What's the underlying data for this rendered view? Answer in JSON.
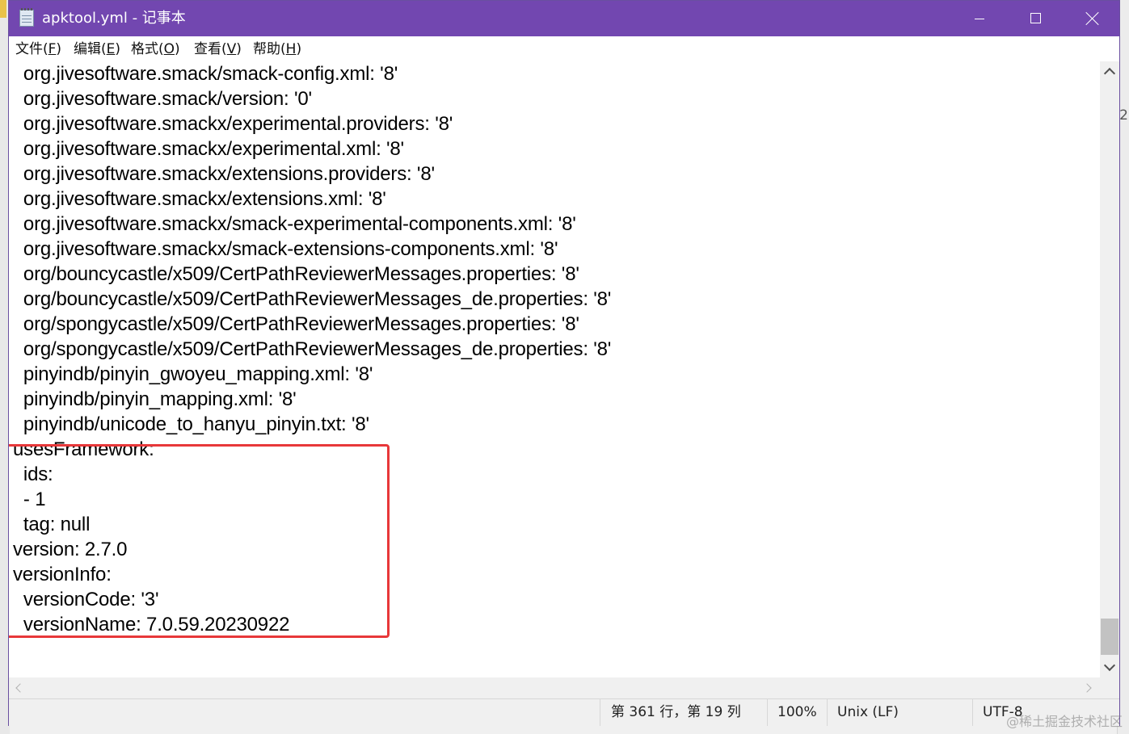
{
  "window": {
    "title": "apktool.yml - 记事本",
    "minimize_label": "minimize",
    "maximize_label": "maximize",
    "close_label": "close"
  },
  "menu": {
    "file": {
      "text": "文件(",
      "accel": "F",
      "end": ")"
    },
    "edit": {
      "text": "编辑(",
      "accel": "E",
      "end": ")"
    },
    "format": {
      "text": "格式(",
      "accel": "O",
      "end": ")"
    },
    "view": {
      "text": "查看(",
      "accel": "V",
      "end": ")"
    },
    "help": {
      "text": "帮助(",
      "accel": "H",
      "end": ")"
    }
  },
  "editor": {
    "lines": [
      "  org.jivesoftware.smack/smack-config.xml: '8'",
      "  org.jivesoftware.smack/version: '0'",
      "  org.jivesoftware.smackx/experimental.providers: '8'",
      "  org.jivesoftware.smackx/experimental.xml: '8'",
      "  org.jivesoftware.smackx/extensions.providers: '8'",
      "  org.jivesoftware.smackx/extensions.xml: '8'",
      "  org.jivesoftware.smackx/smack-experimental-components.xml: '8'",
      "  org.jivesoftware.smackx/smack-extensions-components.xml: '8'",
      "  org/bouncycastle/x509/CertPathReviewerMessages.properties: '8'",
      "  org/bouncycastle/x509/CertPathReviewerMessages_de.properties: '8'",
      "  org/spongycastle/x509/CertPathReviewerMessages.properties: '8'",
      "  org/spongycastle/x509/CertPathReviewerMessages_de.properties: '8'",
      "  pinyindb/pinyin_gwoyeu_mapping.xml: '8'",
      "  pinyindb/pinyin_mapping.xml: '8'",
      "  pinyindb/unicode_to_hanyu_pinyin.txt: '8'",
      "usesFramework:",
      "  ids:",
      "  - 1",
      "  tag: null",
      "version: 2.7.0",
      "versionInfo:",
      "  versionCode: '3'",
      "  versionName: 7.0.59.20230922"
    ],
    "highlight_color": "#e8383a"
  },
  "statusbar": {
    "position": "第 361 行，第 19 列",
    "zoom": "100%",
    "line_ending": "Unix (LF)",
    "encoding": "UTF-8"
  },
  "watermark": "@稀土掘金技术社区",
  "colors": {
    "titlebar": "#7247b0",
    "highlight": "#e8383a"
  }
}
